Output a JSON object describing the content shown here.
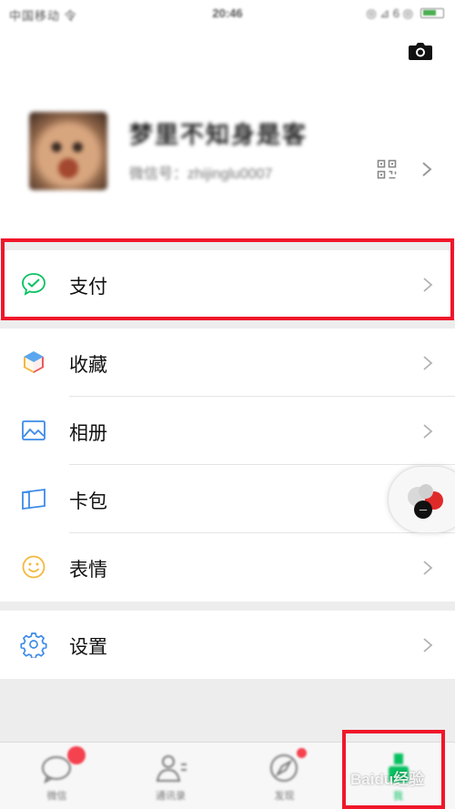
{
  "status_bar": {
    "carrier": "中国移动 令",
    "time": "20:46",
    "icons": "◎ ⊿ 6 ◎"
  },
  "profile": {
    "nickname": "梦里不知身是客",
    "wechat_id": "微信号：zhijinglu0007",
    "camera_icon": "camera-icon",
    "qr_icon": "qr-code-icon"
  },
  "menu": {
    "payment": {
      "label": "支付",
      "icon": "payment-icon"
    },
    "favorites": {
      "label": "收藏",
      "icon": "favorites-cube-icon"
    },
    "album": {
      "label": "相册",
      "icon": "album-image-icon"
    },
    "cards": {
      "label": "卡包",
      "icon": "card-wallet-icon"
    },
    "stickers": {
      "label": "表情",
      "icon": "smiley-icon"
    },
    "settings": {
      "label": "设置",
      "icon": "gear-icon"
    }
  },
  "tabbar": {
    "tabs": [
      {
        "label": "微信",
        "icon": "chat-bubble-icon",
        "has_badge": true
      },
      {
        "label": "通讯录",
        "icon": "contacts-icon",
        "has_badge": false
      },
      {
        "label": "发现",
        "icon": "compass-icon",
        "has_badge": true
      },
      {
        "label": "我",
        "icon": "me-person-icon",
        "has_badge": false,
        "active": true
      }
    ]
  },
  "watermark": "Baidu经验",
  "colors": {
    "highlight_box": "#f0162a",
    "accent_green": "#07c160",
    "badge_red": "#f5424f"
  }
}
